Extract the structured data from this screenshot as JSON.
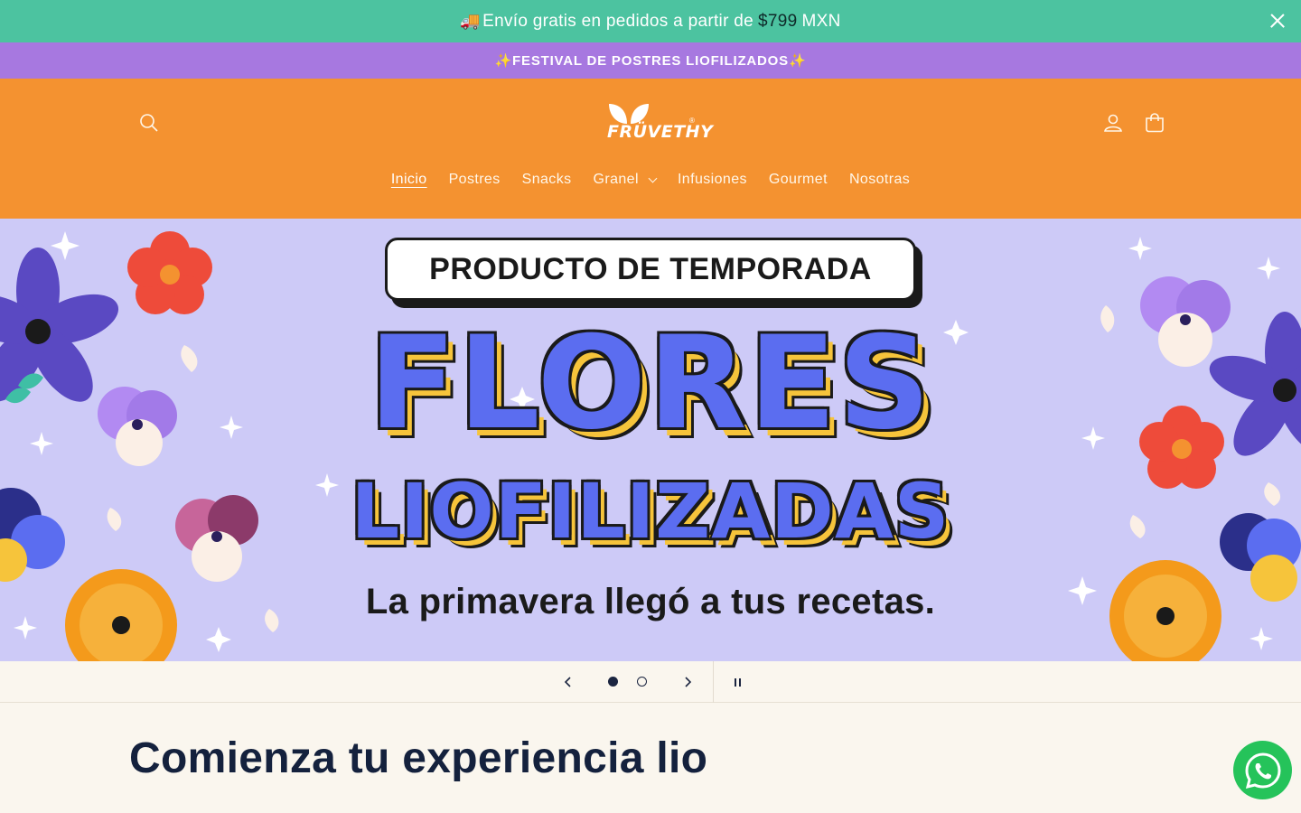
{
  "announcement": {
    "truck_icon": "🚚",
    "text": "Envío gratis en pedidos a partir de",
    "price": "$799",
    "currency": "MXN",
    "close_icon": "close-icon"
  },
  "promo_bar": {
    "sparkle_left": "✨",
    "text": "FESTIVAL DE POSTRES LIOFILIZADOS",
    "sparkle_right": "✨"
  },
  "header": {
    "logo_text": "FRÜVETHY",
    "logo_reg": "®",
    "icons": [
      "search-icon",
      "account-icon",
      "cart-icon"
    ],
    "nav": [
      {
        "label": "Inicio",
        "active": true
      },
      {
        "label": "Postres"
      },
      {
        "label": "Snacks"
      },
      {
        "label": "Granel",
        "dropdown": true
      },
      {
        "label": "Infusiones"
      },
      {
        "label": "Gourmet"
      },
      {
        "label": "Nosotras"
      }
    ]
  },
  "hero": {
    "badge": "PRODUCTO DE TEMPORADA",
    "headline_1": "FLORES",
    "headline_2": "LIOFILIZADAS",
    "tagline": "La primavera llegó a tus recetas.",
    "colors": {
      "background": "#cdcaf7",
      "headline": "#5b6df0",
      "shadow": "#f6c43b"
    }
  },
  "slider": {
    "total_slides": 2,
    "current_slide": 1
  },
  "section": {
    "title": "Comienza tu experiencia lio"
  },
  "colors": {
    "announcement": "#4cc3a0",
    "promo": "#a778e0",
    "header": "#f49230",
    "whatsapp": "#25c35a"
  }
}
